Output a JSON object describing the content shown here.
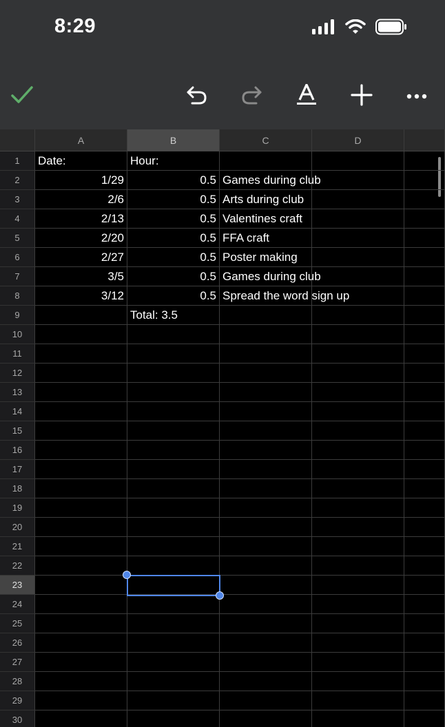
{
  "status": {
    "time": "8:29"
  },
  "toolbar": {
    "icons": [
      "checkmark-icon",
      "undo-icon",
      "redo-icon",
      "text-format-icon",
      "add-icon",
      "more-icon"
    ],
    "accent": "#4CAF50"
  },
  "sheet": {
    "columns": [
      "A",
      "B",
      "C",
      "D"
    ],
    "selected_column": "B",
    "selected_row": 23,
    "row_count": 30,
    "rows": [
      {
        "A": "Date:",
        "B": "Hour:",
        "C": ""
      },
      {
        "A": "1/29",
        "B": "0.5",
        "C": "Games during club"
      },
      {
        "A": "2/6",
        "B": "0.5",
        "C": "Arts during club"
      },
      {
        "A": "2/13",
        "B": "0.5",
        "C": "Valentines craft"
      },
      {
        "A": "2/20",
        "B": "0.5",
        "C": "FFA craft"
      },
      {
        "A": "2/27",
        "B": "0.5",
        "C": "Poster making"
      },
      {
        "A": "3/5",
        "B": "0.5",
        "C": "Games during club"
      },
      {
        "A": "3/12",
        "B": "0.5",
        "C": "Spread the word sign up"
      },
      {
        "A": "",
        "B": "Total: 3.5",
        "C": ""
      }
    ]
  },
  "colors": {
    "selection": "#4f86e8",
    "toolbar_bg": "#333436"
  }
}
